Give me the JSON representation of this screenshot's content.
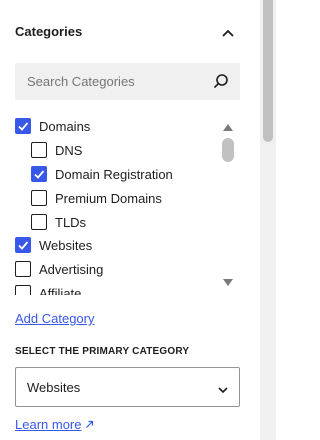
{
  "panel": {
    "title": "Categories",
    "search": {
      "placeholder": "Search Categories",
      "value": ""
    },
    "categories": [
      {
        "label": "Domains",
        "checked": true,
        "level": 0
      },
      {
        "label": "DNS",
        "checked": false,
        "level": 1
      },
      {
        "label": "Domain Registration",
        "checked": true,
        "level": 1
      },
      {
        "label": "Premium Domains",
        "checked": false,
        "level": 1
      },
      {
        "label": "TLDs",
        "checked": false,
        "level": 1
      },
      {
        "label": "Websites",
        "checked": true,
        "level": 0
      },
      {
        "label": "Advertising",
        "checked": false,
        "level": 0
      },
      {
        "label": "Affiliate",
        "checked": false,
        "level": 0
      }
    ],
    "add_category_label": "Add Category",
    "primary_category": {
      "label": "SELECT THE PRIMARY CATEGORY",
      "selected": "Websites"
    },
    "learn_more_label": "Learn more"
  },
  "colors": {
    "accent": "#3858e9",
    "text": "#1e1e1e",
    "search_bg": "#f0f0f0"
  }
}
